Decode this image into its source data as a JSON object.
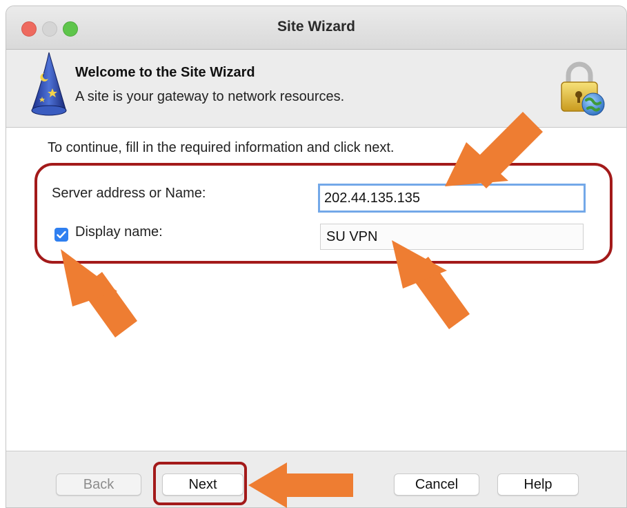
{
  "window": {
    "title": "Site Wizard"
  },
  "header": {
    "title": "Welcome to the Site Wizard",
    "subtitle": "A site is your gateway to network resources.",
    "left_icon": "wizard-hat-icon",
    "right_icon": "lock-globe-icon"
  },
  "content": {
    "instructions": "To continue, fill in the required information and click next.",
    "server_label": "Server address or Name:",
    "server_value": "202.44.135.135",
    "display_name_label": "Display name:",
    "display_name_checked": true,
    "display_name_value": "SU VPN"
  },
  "footer": {
    "back_label": "Back",
    "next_label": "Next",
    "cancel_label": "Cancel",
    "help_label": "Help"
  },
  "annotations": {
    "highlight_color": "#a31a1a",
    "arrow_color": "#ee7d32"
  }
}
